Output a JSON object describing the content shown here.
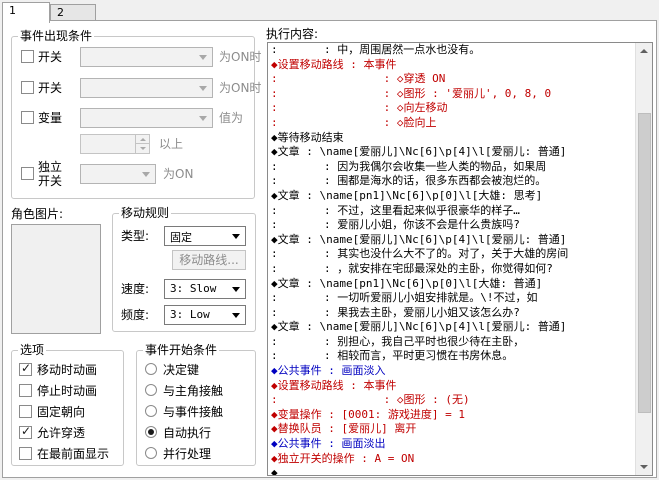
{
  "tabs": [
    {
      "label": "1"
    },
    {
      "label": "2"
    }
  ],
  "conditions": {
    "legend": "事件出现条件",
    "switch1": {
      "label": "开关",
      "suffix": "为ON时"
    },
    "switch2": {
      "label": "开关",
      "suffix": "为ON时"
    },
    "variable": {
      "label": "变量",
      "suffix": "值为",
      "above": "以上"
    },
    "self_switch": {
      "label_line1": "独立",
      "label_line2": "开关",
      "suffix": "为ON"
    }
  },
  "character_image": {
    "label": "角色图片:"
  },
  "movement": {
    "legend": "移动规则",
    "type_label": "类型:",
    "type_value": "固定",
    "route_button": "移动路线...",
    "speed_label": "速度:",
    "speed_value": "3: Slow",
    "freq_label": "频度:",
    "freq_value": "3: Low"
  },
  "options": {
    "legend": "选项",
    "items": [
      {
        "label": "移动时动画",
        "checked": true
      },
      {
        "label": "停止时动画",
        "checked": false
      },
      {
        "label": "固定朝向",
        "checked": false
      },
      {
        "label": "允许穿透",
        "checked": true
      },
      {
        "label": "在最前面显示",
        "checked": false
      }
    ]
  },
  "trigger": {
    "legend": "事件开始条件",
    "items": [
      {
        "label": "决定键",
        "checked": false
      },
      {
        "label": "与主角接触",
        "checked": false
      },
      {
        "label": "与事件接触",
        "checked": false
      },
      {
        "label": "自动执行",
        "checked": true
      },
      {
        "label": "并行处理",
        "checked": false
      }
    ]
  },
  "contents": {
    "label": "执行内容:",
    "lines": [
      {
        "text": ":       : 中，周围居然一点水也没有。",
        "color": "#000000"
      },
      {
        "text": "◆设置移动路线 : 本事件",
        "color": "#c00000"
      },
      {
        "text": ":                : ◇穿透 ON",
        "color": "#c00000"
      },
      {
        "text": ":                : ◇图形 : '爱丽儿', 0, 8, 0",
        "color": "#c00000"
      },
      {
        "text": ":                : ◇向左移动",
        "color": "#c00000"
      },
      {
        "text": ":                : ◇脸向上",
        "color": "#c00000"
      },
      {
        "text": "◆等待移动结束",
        "color": "#000000"
      },
      {
        "text": "◆文章 : \\name[爱丽儿]\\Nc[6]\\p[4]\\l[爱丽儿: 普通]",
        "color": "#000000"
      },
      {
        "text": ":       : 因为我偶尔会收集一些人类的物品，如果周",
        "color": "#000000"
      },
      {
        "text": ":       : 围都是海水的话，很多东西都会被泡烂的。",
        "color": "#000000"
      },
      {
        "text": "◆文章 : \\name[pn1]\\Nc[6]\\p[0]\\l[大雄: 思考]",
        "color": "#000000"
      },
      {
        "text": ":       : 不过，这里看起来似乎很豪华的样子…",
        "color": "#000000"
      },
      {
        "text": ":       : 爱丽儿小姐，你该不会是什么贵族吗?",
        "color": "#000000"
      },
      {
        "text": "◆文章 : \\name[爱丽儿]\\Nc[6]\\p[4]\\l[爱丽儿: 普通]",
        "color": "#000000"
      },
      {
        "text": ":       : 其实也没什么大不了的。对了，关于大雄的房间",
        "color": "#000000"
      },
      {
        "text": ":       : ，就安排在宅邸最深处的主卧，你觉得如何?",
        "color": "#000000"
      },
      {
        "text": "◆文章 : \\name[pn1]\\Nc[6]\\p[0]\\l[大雄: 普通]",
        "color": "#000000"
      },
      {
        "text": ":       : 一切听爱丽儿小姐安排就是。\\!不过，如",
        "color": "#000000"
      },
      {
        "text": ":       : 果我去主卧，爱丽儿小姐又该怎么办?",
        "color": "#000000"
      },
      {
        "text": "◆文章 : \\name[爱丽儿]\\Nc[6]\\p[4]\\l[爱丽儿: 普通]",
        "color": "#000000"
      },
      {
        "text": ":       : 别担心，我自己平时也很少待在主卧，",
        "color": "#000000"
      },
      {
        "text": ":       : 相较而言，平时更习惯在书房休息。",
        "color": "#000000"
      },
      {
        "text": "◆公共事件 : 画面淡入",
        "color": "#0000c0"
      },
      {
        "text": "◆设置移动路线 : 本事件",
        "color": "#c00000"
      },
      {
        "text": ":                : ◇图形 : (无)",
        "color": "#c00000"
      },
      {
        "text": "◆变量操作 : [0001: 游戏进度] = 1",
        "color": "#c00000"
      },
      {
        "text": "◆替换队员 : [爱丽儿] 离开",
        "color": "#c00000"
      },
      {
        "text": "◆公共事件 : 画面淡出",
        "color": "#0000c0"
      },
      {
        "text": "◆独立开关的操作 : A = ON",
        "color": "#c00000"
      },
      {
        "text": "◆",
        "color": "#000000"
      }
    ]
  }
}
